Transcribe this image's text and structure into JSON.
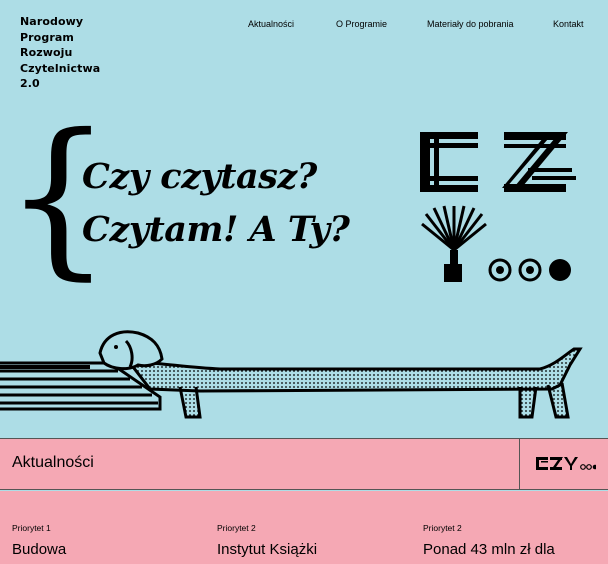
{
  "program_name": [
    "Narodowy",
    "Program",
    "Rozwoju",
    "Czytelnictwa",
    "2.0"
  ],
  "nav": [
    "Aktualności",
    "O Programie",
    "Materiały do pobrania",
    "Kontakt"
  ],
  "hero": {
    "brace": "{",
    "lines": [
      "Czy czytasz?",
      "Czytam! A Ty?"
    ]
  },
  "section": {
    "title": "Aktualności"
  },
  "cards": [
    {
      "priority": "Priorytet 1",
      "title": "Budowa"
    },
    {
      "priority": "Priorytet 2",
      "title": "Instytut Książki"
    },
    {
      "priority": "Priorytet 2",
      "title": "Ponad 43 mln zł dla"
    }
  ],
  "colors": {
    "background": "#addde6",
    "accent": "#f5a8b4",
    "ink": "#000000"
  },
  "icons": [
    "cz-brand-logo-icon",
    "dachshund-on-bench-illustration",
    "czy-mini-logo-icon"
  ]
}
